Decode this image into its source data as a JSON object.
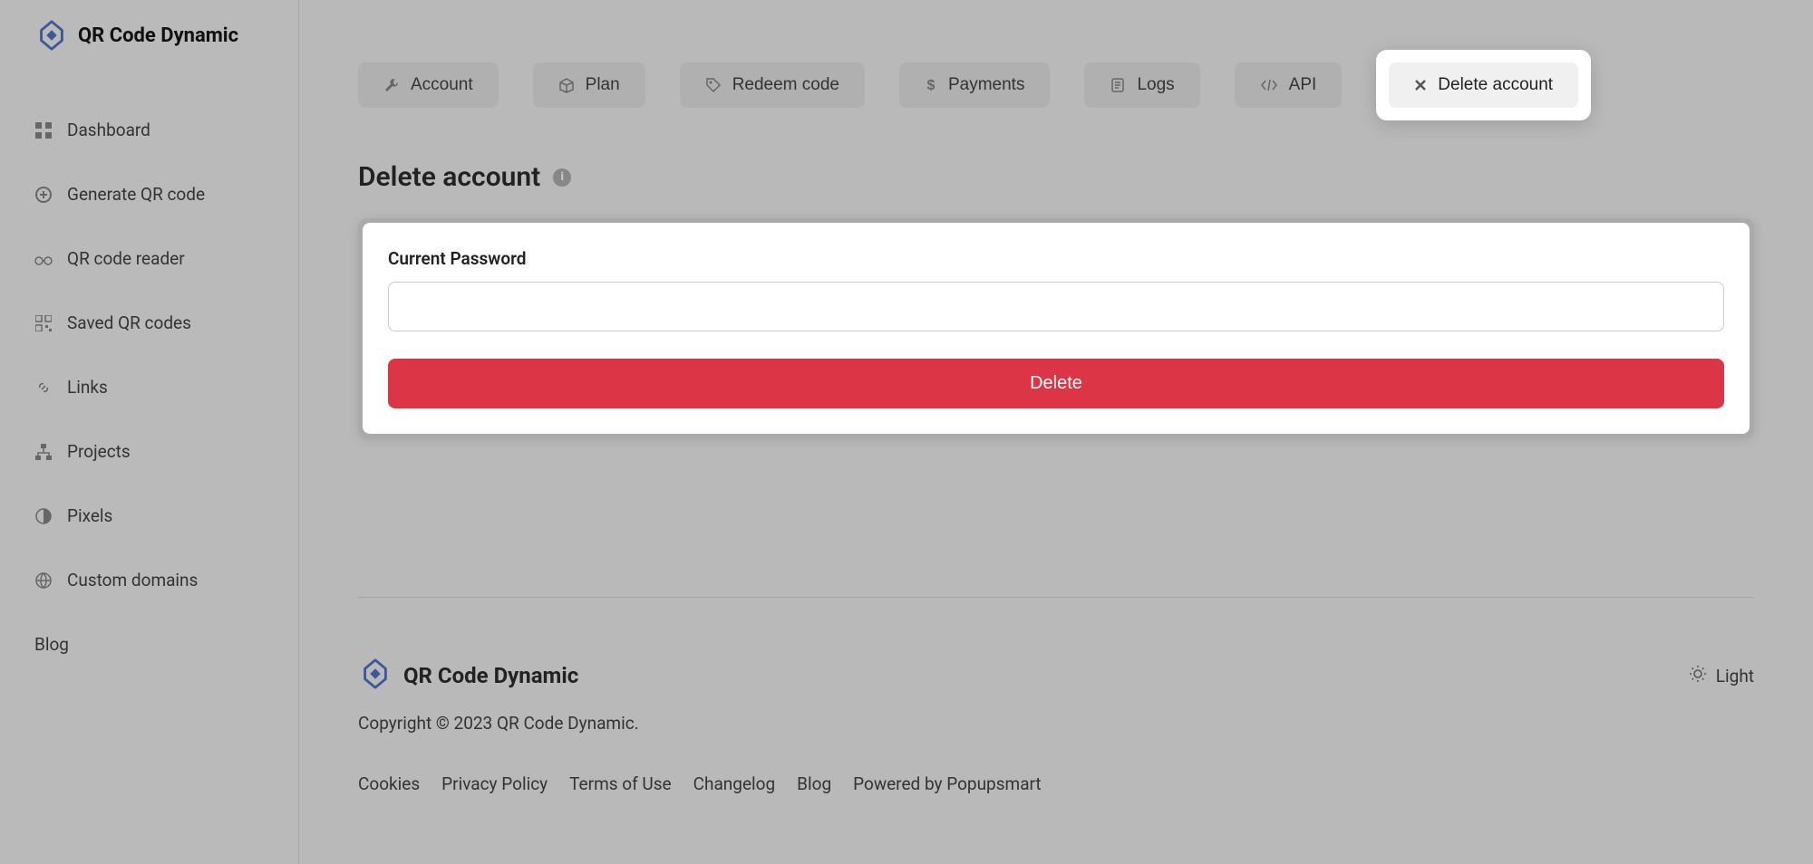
{
  "brand": {
    "name": "QR Code Dynamic"
  },
  "sidebar": {
    "items": [
      {
        "label": "Dashboard"
      },
      {
        "label": "Generate QR code"
      },
      {
        "label": "QR code reader"
      },
      {
        "label": "Saved QR codes"
      },
      {
        "label": "Links"
      },
      {
        "label": "Projects"
      },
      {
        "label": "Pixels"
      },
      {
        "label": "Custom domains"
      },
      {
        "label": "Blog"
      }
    ]
  },
  "tabs": {
    "account": "Account",
    "plan": "Plan",
    "redeem": "Redeem code",
    "payments": "Payments",
    "logs": "Logs",
    "api": "API",
    "delete": "Delete account"
  },
  "page": {
    "title": "Delete account",
    "form": {
      "password_label": "Current Password",
      "delete_button": "Delete"
    }
  },
  "footer": {
    "brand": "QR Code Dynamic",
    "copyright": "Copyright © 2023 QR Code Dynamic.",
    "theme": "Light",
    "links": {
      "cookies": "Cookies",
      "privacy": "Privacy Policy",
      "terms": "Terms of Use",
      "changelog": "Changelog",
      "blog": "Blog",
      "powered": "Powered by Popupsmart"
    }
  }
}
